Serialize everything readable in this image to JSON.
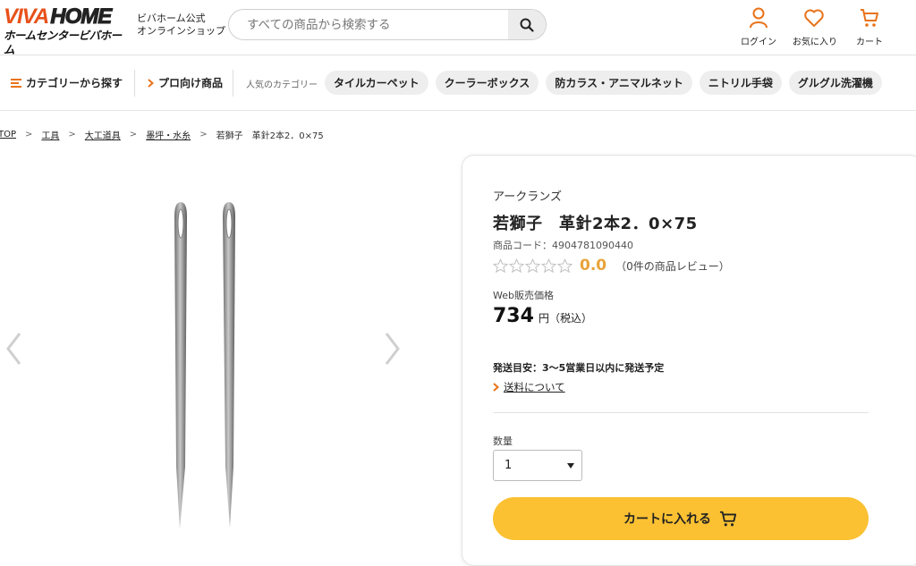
{
  "header": {
    "logo_top_red": "VIVA",
    "logo_top_dark": "HOME",
    "logo_bottom": "ホームセンタービバホーム",
    "site_label_line1": "ビバホーム公式",
    "site_label_line2": "オンラインショップ",
    "search_placeholder": "すべての商品から検索する",
    "icons": {
      "login": "ログイン",
      "favorites": "お気に入り",
      "cart": "カート"
    }
  },
  "nav": {
    "category": "カテゴリーから探す",
    "pro": "プロ向け商品",
    "popular_label": "人気のカテゴリー",
    "chips": [
      "タイルカーペット",
      "クーラーボックス",
      "防カラス・アニマルネット",
      "ニトリル手袋",
      "グルグル洗濯機"
    ]
  },
  "breadcrumb": {
    "items": [
      "TOP",
      "工具",
      "大工道具",
      "墨坪・水糸"
    ],
    "current": "若獅子　革針2本2．0×75",
    "separator": ">"
  },
  "product": {
    "maker": "アークランズ",
    "name": "若獅子　革針2本2．0×75",
    "code": "商品コード：4904781090440",
    "rating": 0.0,
    "score_text": "0.0",
    "review_text": "（0件の商品レビュー）",
    "price_label": "Web販売価格",
    "price": "734",
    "price_unit": "円（税込）",
    "shipping": "発送目安：3〜5営業日以内に発送予定",
    "shipping_link": "送料について",
    "qty_label": "数量",
    "qty_value": "1",
    "cart_button": "カートに入れる"
  },
  "colors": {
    "accent": "#fbc132",
    "brand_red": "#e8501a",
    "rating": "#e8a33a"
  }
}
